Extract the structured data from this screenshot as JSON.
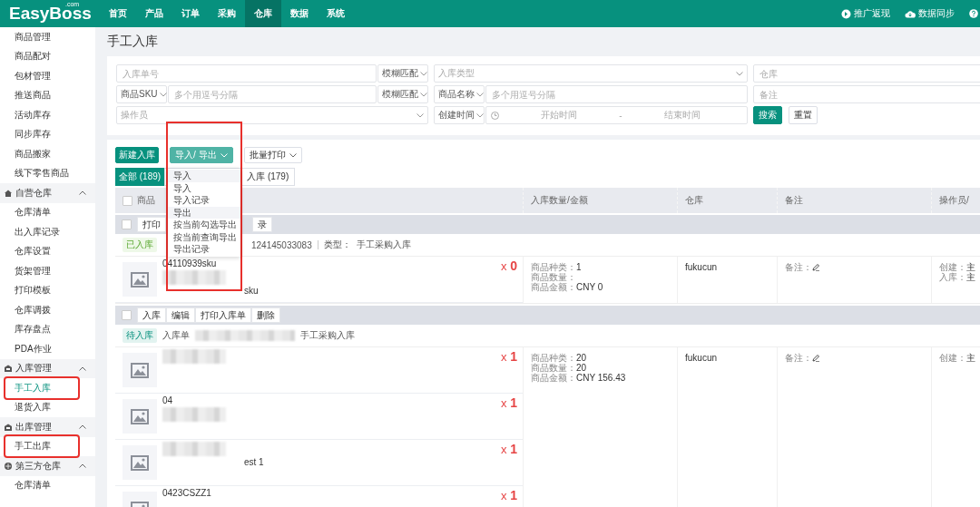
{
  "header": {
    "logo": "EasyBoss",
    "logo_suffix": ".com",
    "nav": [
      {
        "label": "首页",
        "selected": false
      },
      {
        "label": "产品",
        "selected": false
      },
      {
        "label": "订单",
        "selected": false
      },
      {
        "label": "采购",
        "selected": false
      },
      {
        "label": "仓库",
        "selected": true
      },
      {
        "label": "数据",
        "selected": false
      },
      {
        "label": "系统",
        "selected": false
      }
    ],
    "actions": [
      {
        "label": "推广返现",
        "kind": "promo"
      },
      {
        "label": "数据同步",
        "kind": "sync"
      },
      {
        "kind": "help"
      }
    ]
  },
  "sidebar": {
    "sections": [
      {
        "items": [
          {
            "label": "商品管理",
            "selected": false,
            "highlighted": false
          },
          {
            "label": "商品配对",
            "selected": false,
            "highlighted": false
          },
          {
            "label": "包材管理",
            "selected": false,
            "highlighted": false
          },
          {
            "label": "推送商品",
            "selected": false,
            "highlighted": false
          },
          {
            "label": "活动库存",
            "selected": false,
            "highlighted": false
          },
          {
            "label": "同步库存",
            "selected": false,
            "highlighted": false
          },
          {
            "label": "商品搬家",
            "selected": false,
            "highlighted": false
          },
          {
            "label": "线下零售商品",
            "selected": false,
            "highlighted": false
          }
        ]
      },
      {
        "title": "自营仓库",
        "kind": "home",
        "expanded": true,
        "items": [
          {
            "label": "仓库清单",
            "selected": false,
            "highlighted": false
          },
          {
            "label": "出入库记录",
            "selected": false,
            "highlighted": false
          },
          {
            "label": "仓库设置",
            "selected": false,
            "highlighted": false
          },
          {
            "label": "货架管理",
            "selected": false,
            "highlighted": false
          },
          {
            "label": "打印模板",
            "selected": false,
            "highlighted": false
          },
          {
            "label": "仓库调拨",
            "selected": false,
            "highlighted": false
          },
          {
            "label": "库存盘点",
            "selected": false,
            "highlighted": false
          },
          {
            "label": "PDA作业",
            "selected": false,
            "highlighted": false
          }
        ]
      },
      {
        "title": "入库管理",
        "kind": "box",
        "expanded": true,
        "items": [
          {
            "label": "手工入库",
            "selected": true,
            "highlighted": true
          },
          {
            "label": "退货入库",
            "selected": false,
            "highlighted": false
          }
        ]
      },
      {
        "title": "出库管理",
        "kind": "box",
        "expanded": true,
        "items": [
          {
            "label": "手工出库",
            "selected": false,
            "highlighted": true
          }
        ]
      },
      {
        "title": "第三方仓库",
        "kind": "globe",
        "expanded": true,
        "items": [
          {
            "label": "仓库清单",
            "selected": false,
            "highlighted": false
          }
        ]
      }
    ]
  },
  "page": {
    "title": "手工入库"
  },
  "filters": {
    "rows": [
      {
        "cells": [
          {
            "parts": [
              {
                "kind": "input",
                "placeholder": "入库单号"
              },
              {
                "kind": "match",
                "value": "模糊匹配"
              }
            ]
          },
          {
            "parts": [
              {
                "kind": "select",
                "placeholder": "入库类型"
              }
            ]
          },
          {
            "parts": [
              {
                "kind": "input",
                "placeholder": "仓库"
              }
            ]
          }
        ]
      },
      {
        "cells": [
          {
            "parts": [
              {
                "kind": "prefix",
                "value": "商品SKU"
              },
              {
                "kind": "input",
                "placeholder": "多个用逗号分隔"
              },
              {
                "kind": "match",
                "value": "模糊匹配"
              }
            ]
          },
          {
            "parts": [
              {
                "kind": "prefix",
                "value": "商品名称"
              },
              {
                "kind": "input",
                "placeholder": "多个用逗号分隔"
              }
            ]
          },
          {
            "parts": [
              {
                "kind": "input",
                "placeholder": "备注"
              }
            ]
          }
        ]
      },
      {
        "cells": [
          {
            "parts": [
              {
                "kind": "select",
                "placeholder": "操作员"
              }
            ]
          },
          {
            "parts": [
              {
                "kind": "prefix",
                "value": "创建时间"
              },
              {
                "kind": "date",
                "start": "开始时间",
                "separator": "-",
                "end": "结束时间"
              }
            ]
          },
          {
            "parts": [
              {
                "kind": "primary",
                "value": "搜索"
              },
              {
                "kind": "plain",
                "value": "重置"
              }
            ]
          }
        ]
      }
    ]
  },
  "toolbar": [
    {
      "label": "新建入库",
      "kind": "primary"
    },
    {
      "label": "导入/ 导出",
      "kind": "dropdown",
      "open": true,
      "highlighted": true,
      "menu": [
        {
          "label": "导入",
          "kind": "header"
        },
        {
          "label": "导入",
          "kind": "item"
        },
        {
          "label": "导入记录",
          "kind": "item"
        },
        {
          "label": "导出",
          "kind": "header"
        },
        {
          "label": "按当前勾选导出",
          "kind": "item"
        },
        {
          "label": "按当前查询导出",
          "kind": "item"
        },
        {
          "label": "导出记录",
          "kind": "item"
        }
      ]
    },
    {
      "label": "批量打印",
      "kind": "dropdown",
      "open": false
    }
  ],
  "tabs": [
    {
      "label": "全部 (189)",
      "selected": true
    },
    {
      "label": "入库 (179)",
      "selected": false
    }
  ],
  "table": {
    "all_checked": false,
    "columns": [
      "商品",
      "入库数量/金额",
      "仓库",
      "备注",
      "操作员/"
    ],
    "orders": [
      {
        "checked": false,
        "actions": [
          "打印",
          "录"
        ],
        "status": {
          "label": "已入库",
          "kind": "done"
        },
        "order_no": "124145033083",
        "type_label": "类型：",
        "type": "手工采购入库",
        "items": [
          {
            "code": "04110939sku",
            "note": "sku",
            "blurred": true,
            "quantity": "x **0**"
          }
        ],
        "stats": [
          {
            "label": "商品种类：",
            "value": "1"
          },
          {
            "label": "商品数量："
          },
          {
            "label": "商品金额：",
            "value": "CNY 0"
          }
        ],
        "warehouse": "fukucun",
        "remark_label": "备注：",
        "operator": [
          {
            "label": "创建：",
            "value": "主"
          },
          {
            "label": "入库：",
            "value": "主"
          }
        ]
      },
      {
        "checked": false,
        "actions": [
          "入库",
          "编辑",
          "打印入库单",
          "删除"
        ],
        "status": {
          "label": "待入库",
          "kind": "pending"
        },
        "order_label": "入库单",
        "type": "手工采购入库",
        "items": [
          {
            "blurred": true,
            "quantity": "x **1**"
          },
          {
            "code": "04",
            "blurred": true,
            "quantity": "x **1**"
          },
          {
            "note": "est 1",
            "blurred": true,
            "quantity": "x **1**"
          },
          {
            "code": "0423CSZZ1",
            "blurred": false,
            "quantity": "x **1**"
          }
        ],
        "stats": [
          {
            "label": "商品种类：",
            "value": "20"
          },
          {
            "label": "商品数量：",
            "value": "20"
          },
          {
            "label": "商品金额：",
            "value": "CNY 156.43"
          }
        ],
        "warehouse": "fukucun",
        "remark_label": "备注：",
        "operator": [
          {
            "label": "创建：",
            "value": "主"
          }
        ]
      }
    ]
  }
}
